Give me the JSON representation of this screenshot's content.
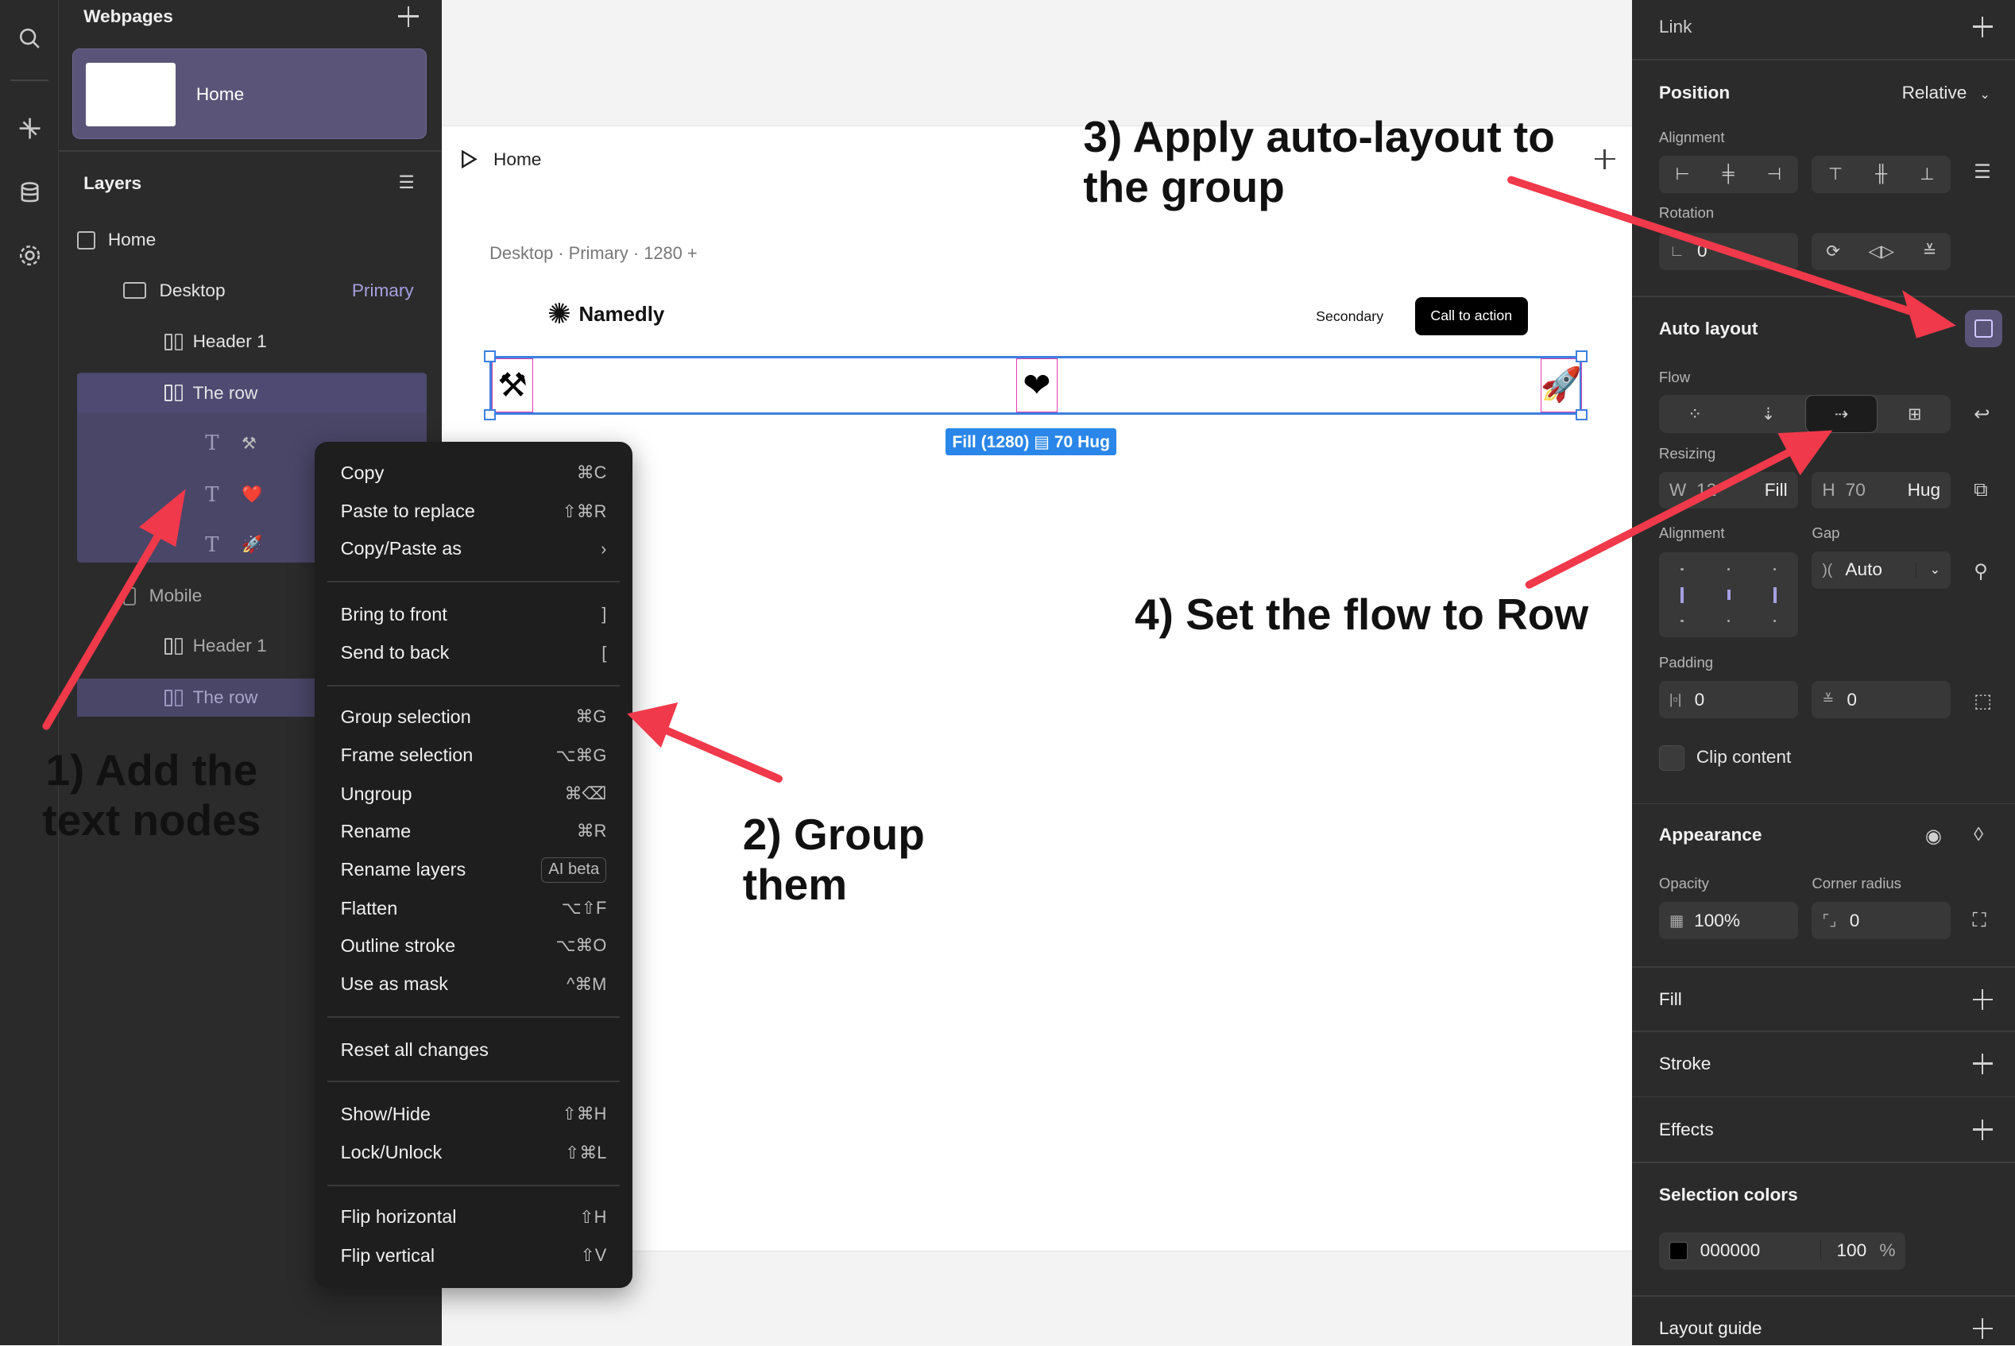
{
  "left_panel": {
    "webpages_title": "Webpages",
    "home_card_label": "Home",
    "layers_title": "Layers",
    "layers": [
      {
        "label": "Home",
        "tag": ""
      },
      {
        "label": "Desktop",
        "tag": "Primary"
      },
      {
        "label": "Header 1",
        "tag": ""
      },
      {
        "label": "The row",
        "tag": ""
      },
      {
        "label": "⚒",
        "tag": ""
      },
      {
        "label": "❤️",
        "tag": ""
      },
      {
        "label": "🚀",
        "tag": ""
      },
      {
        "label": "Mobile",
        "tag": ""
      },
      {
        "label": "Header 1",
        "tag": ""
      },
      {
        "label": "The row",
        "tag": ""
      }
    ]
  },
  "canvas": {
    "page_tab": "Home",
    "breakpoint_label": "Desktop · Primary · 1280 +",
    "logo_text": "Namedly",
    "logo_icon": "✺",
    "secondary_label": "Secondary",
    "cta_label": "Call to action",
    "row_emojis": [
      "⚒",
      "❤",
      "🚀"
    ],
    "size_badge": "Fill (1280) ▤ 70 Hug"
  },
  "context_menu": {
    "items": [
      {
        "label": "Copy",
        "shortcut": "⌘C"
      },
      {
        "label": "Paste to replace",
        "shortcut": "⇧⌘R"
      },
      {
        "label": "Copy/Paste as",
        "shortcut": "›"
      },
      {
        "label": "Bring to front",
        "shortcut": "]"
      },
      {
        "label": "Send to back",
        "shortcut": "["
      },
      {
        "label": "Group selection",
        "shortcut": "⌘G"
      },
      {
        "label": "Frame selection",
        "shortcut": "⌥⌘G"
      },
      {
        "label": "Ungroup",
        "shortcut": "⌘⌫"
      },
      {
        "label": "Rename",
        "shortcut": "⌘R"
      },
      {
        "label": "Rename layers",
        "shortcut": "AI beta"
      },
      {
        "label": "Flatten",
        "shortcut": "⌥⇧F"
      },
      {
        "label": "Outline stroke",
        "shortcut": "⌥⌘O"
      },
      {
        "label": "Use as mask",
        "shortcut": "^⌘M"
      },
      {
        "label": "Reset all changes",
        "shortcut": ""
      },
      {
        "label": "Show/Hide",
        "shortcut": "⇧⌘H"
      },
      {
        "label": "Lock/Unlock",
        "shortcut": "⇧⌘L"
      },
      {
        "label": "Flip horizontal",
        "shortcut": "⇧H"
      },
      {
        "label": "Flip vertical",
        "shortcut": "⇧V"
      }
    ]
  },
  "right_panel": {
    "link_title": "Link",
    "position_title": "Position",
    "position_value": "Relative",
    "alignment_label": "Alignment",
    "rotation_label": "Rotation",
    "rotation_value": "0",
    "auto_layout_title": "Auto layout",
    "flow_label": "Flow",
    "resizing_label": "Resizing",
    "width_prefix": "W",
    "width_value": "12",
    "width_mode": "Fill",
    "height_prefix": "H",
    "height_value": "70",
    "height_mode": "Hug",
    "al_alignment_label": "Alignment",
    "gap_label": "Gap",
    "gap_value": "Auto",
    "padding_label": "Padding",
    "padding_h": "0",
    "padding_v": "0",
    "clip_label": "Clip content",
    "appearance_title": "Appearance",
    "opacity_label": "Opacity",
    "opacity_value": "100%",
    "corner_label": "Corner radius",
    "corner_value": "0",
    "fill_title": "Fill",
    "stroke_title": "Stroke",
    "effects_title": "Effects",
    "selection_colors_title": "Selection colors",
    "sel_color_hex": "000000",
    "sel_color_opacity": "100",
    "sel_color_pct": "%",
    "layout_guide_title": "Layout guide"
  },
  "annotations": {
    "step1": "1) Add the text nodes",
    "step2": "2) Group them",
    "step3": "3) Apply auto-layout to the group",
    "step4": "4) Set the flow to Row"
  },
  "colors": {
    "accent_blue": "#2a86e8",
    "selection_purple": "#5a5578",
    "arrow_red": "#f0394a"
  }
}
